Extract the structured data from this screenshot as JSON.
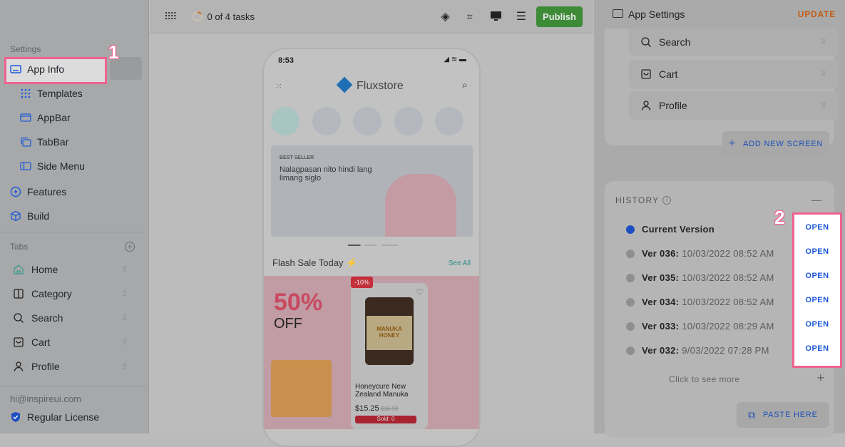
{
  "sidebar": {
    "settings_label": "Settings",
    "settings_items": [
      {
        "label": "App Info",
        "icon": "app-info-icon"
      },
      {
        "label": "Templates",
        "icon": "templates-icon"
      },
      {
        "label": "AppBar",
        "icon": "appbar-icon"
      },
      {
        "label": "TabBar",
        "icon": "tabbar-icon"
      },
      {
        "label": "Side Menu",
        "icon": "side-menu-icon"
      },
      {
        "label": "Features",
        "icon": "lightning-icon"
      },
      {
        "label": "Build",
        "icon": "box-icon"
      }
    ],
    "tabs_label": "Tabs",
    "tabs": [
      {
        "label": "Home"
      },
      {
        "label": "Category"
      },
      {
        "label": "Search"
      },
      {
        "label": "Cart"
      },
      {
        "label": "Profile"
      }
    ],
    "email": "hi@inspireui.com",
    "license": "Regular License"
  },
  "annotations": {
    "one": "1",
    "two": "2",
    "highlight_color": "#f0628e"
  },
  "toolbar": {
    "tasks": "0 of 4 tasks",
    "publish": "Publish",
    "publish_color": "#3d8b37"
  },
  "phone": {
    "time": "8:53",
    "brand": "Fluxstore",
    "banner": {
      "tag": "BEST SELLER",
      "text": "Nalagpasan nito hindi lang limang siglo"
    },
    "flash_title": "Flash Sale Today ⚡",
    "see_all": "See All",
    "promo": {
      "big": "50%",
      "off": "OFF"
    },
    "product": {
      "discount": "-10%",
      "brand_label": "HONEYCURE",
      "jar_text": "MANUKA HONEY",
      "name": "Honeycure New Zealand Manuka",
      "price": "$15.25",
      "old_price": "$16.99",
      "sold": "Sold: 0"
    }
  },
  "right": {
    "title": "App Settings",
    "update": "UPDATE",
    "screens": [
      {
        "label": "Search"
      },
      {
        "label": "Cart"
      },
      {
        "label": "Profile"
      }
    ],
    "add_screen": "ADD NEW SCREEN",
    "history_title": "HISTORY",
    "history": [
      {
        "label": "Current Version",
        "date": "",
        "current": true
      },
      {
        "label": "Ver 036:",
        "date": "10/03/2022 08:52 AM"
      },
      {
        "label": "Ver 035:",
        "date": "10/03/2022 08:52 AM"
      },
      {
        "label": "Ver 034:",
        "date": "10/03/2022 08:52 AM"
      },
      {
        "label": "Ver 033:",
        "date": "10/03/2022 08:29 AM"
      },
      {
        "label": "Ver 032:",
        "date": "9/03/2022 07:28 PM"
      }
    ],
    "open": "OPEN",
    "see_more": "Click to see more",
    "paste": "PASTE HERE"
  }
}
